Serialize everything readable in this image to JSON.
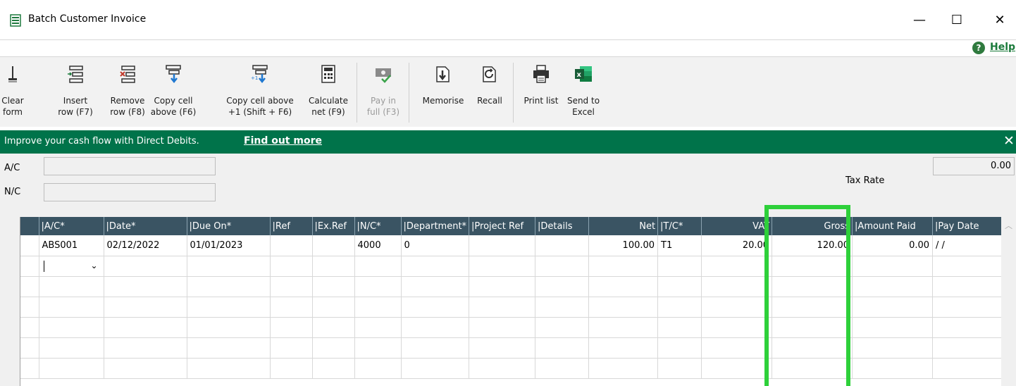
{
  "window": {
    "title": "Batch Customer Invoice",
    "minimize": "—",
    "maximize": "☐",
    "close": "✕"
  },
  "help": {
    "icon": "?",
    "label": "Help"
  },
  "toolbar": [
    {
      "id": "clear-form",
      "label": "Clear\nform",
      "icon": "clear-form-icon",
      "disabled": false
    },
    {
      "id": "insert-row",
      "label": "Insert\nrow (F7)",
      "icon": "insert-row-icon",
      "disabled": false
    },
    {
      "id": "remove-row",
      "label": "Remove\nrow (F8)",
      "icon": "remove-row-icon",
      "disabled": false
    },
    {
      "id": "copy-cell-above",
      "label": "Copy cell\nabove (F6)",
      "icon": "copy-cell-above-icon",
      "disabled": false
    },
    {
      "id": "copy-cell-above-plus1",
      "label": "Copy cell above\n+1 (Shift + F6)",
      "icon": "copy-cell-plus1-icon",
      "disabled": false
    },
    {
      "id": "calculate-net",
      "label": "Calculate\nnet (F9)",
      "icon": "calculator-icon",
      "disabled": false
    },
    {
      "id": "pay-in-full",
      "label": "Pay in\nfull (F3)",
      "icon": "pay-in-full-icon",
      "disabled": true
    },
    {
      "id": "memorise",
      "label": "Memorise",
      "icon": "memorise-icon",
      "disabled": false
    },
    {
      "id": "recall",
      "label": "Recall",
      "icon": "recall-icon",
      "disabled": false
    },
    {
      "id": "print-list",
      "label": "Print list",
      "icon": "printer-icon",
      "disabled": false
    },
    {
      "id": "send-to-excel",
      "label": "Send to\nExcel",
      "icon": "excel-icon",
      "disabled": false
    }
  ],
  "banner": {
    "text": "Improve your cash flow with Direct Debits.",
    "link": "Find out more",
    "close": "✕"
  },
  "fields": {
    "ac_label": "A/C",
    "ac_value": "",
    "nc_label": "N/C",
    "nc_value": "",
    "tax_rate_label": "Tax Rate",
    "tax_rate_value": "0.00"
  },
  "grid": {
    "columns": [
      "|A/C*",
      "|Date*",
      "|Due On*",
      "|Ref",
      "|Ex.Ref",
      "|N/C*",
      "|Department*",
      "|Project Ref",
      "|Details",
      "Net",
      "|T/C*",
      "VAT",
      "Gross",
      "|Amount Paid",
      "|Pay Date"
    ],
    "rows": [
      [
        "ABS001",
        "02/12/2022",
        "01/01/2023",
        "",
        "",
        "4000",
        "0",
        "",
        "",
        "100.00",
        "T1",
        "20.00",
        "120.00",
        "0.00",
        "/ /"
      ]
    ]
  },
  "colors": {
    "header_bg": "#3a5463",
    "banner_bg": "#00734a",
    "highlight": "#2ed03a"
  }
}
